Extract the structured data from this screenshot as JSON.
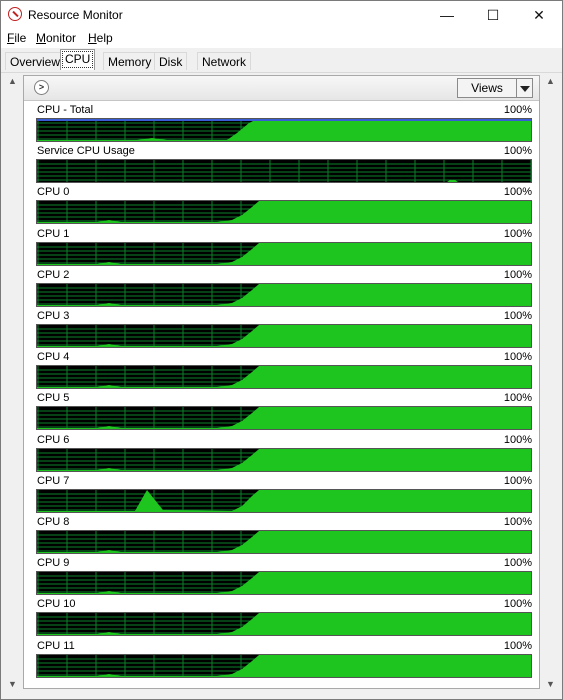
{
  "window": {
    "title": "Resource Monitor",
    "minimize": "—",
    "maximize": "☐",
    "close": "✕"
  },
  "menubar": {
    "file_u": "F",
    "file_rest": "ile",
    "monitor_u": "M",
    "monitor_rest": "onitor",
    "help_u": "H",
    "help_rest": "elp"
  },
  "tabs": [
    {
      "label": "Overview",
      "active": false
    },
    {
      "label": "CPU",
      "active": true
    },
    {
      "label": "Memory",
      "active": false
    },
    {
      "label": "Disk",
      "active": false
    },
    {
      "label": "Network",
      "active": false
    }
  ],
  "panel": {
    "collapse_icon": "chevron-right-icon",
    "views_label": "Views"
  },
  "graphs": [
    {
      "label": "CPU - Total",
      "percent": "100%",
      "profile": "total"
    },
    {
      "label": "Service CPU Usage",
      "percent": "100%",
      "profile": "service"
    },
    {
      "label": "CPU 0",
      "percent": "100%",
      "profile": "core"
    },
    {
      "label": "CPU 1",
      "percent": "100%",
      "profile": "core"
    },
    {
      "label": "CPU 2",
      "percent": "100%",
      "profile": "core"
    },
    {
      "label": "CPU 3",
      "percent": "100%",
      "profile": "core"
    },
    {
      "label": "CPU 4",
      "percent": "100%",
      "profile": "core"
    },
    {
      "label": "CPU 5",
      "percent": "100%",
      "profile": "core"
    },
    {
      "label": "CPU 6",
      "percent": "100%",
      "profile": "core"
    },
    {
      "label": "CPU 7",
      "percent": "100%",
      "profile": "spike"
    },
    {
      "label": "CPU 8",
      "percent": "100%",
      "profile": "core"
    },
    {
      "label": "CPU 9",
      "percent": "100%",
      "profile": "core"
    },
    {
      "label": "CPU 10",
      "percent": "100%",
      "profile": "core"
    },
    {
      "label": "CPU 11",
      "percent": "100%",
      "profile": "core"
    }
  ],
  "colors": {
    "graph_bg": "#000000",
    "grid": "#0b7f2a",
    "fill": "#1ec51e",
    "total_line": "#3a5bd6"
  }
}
